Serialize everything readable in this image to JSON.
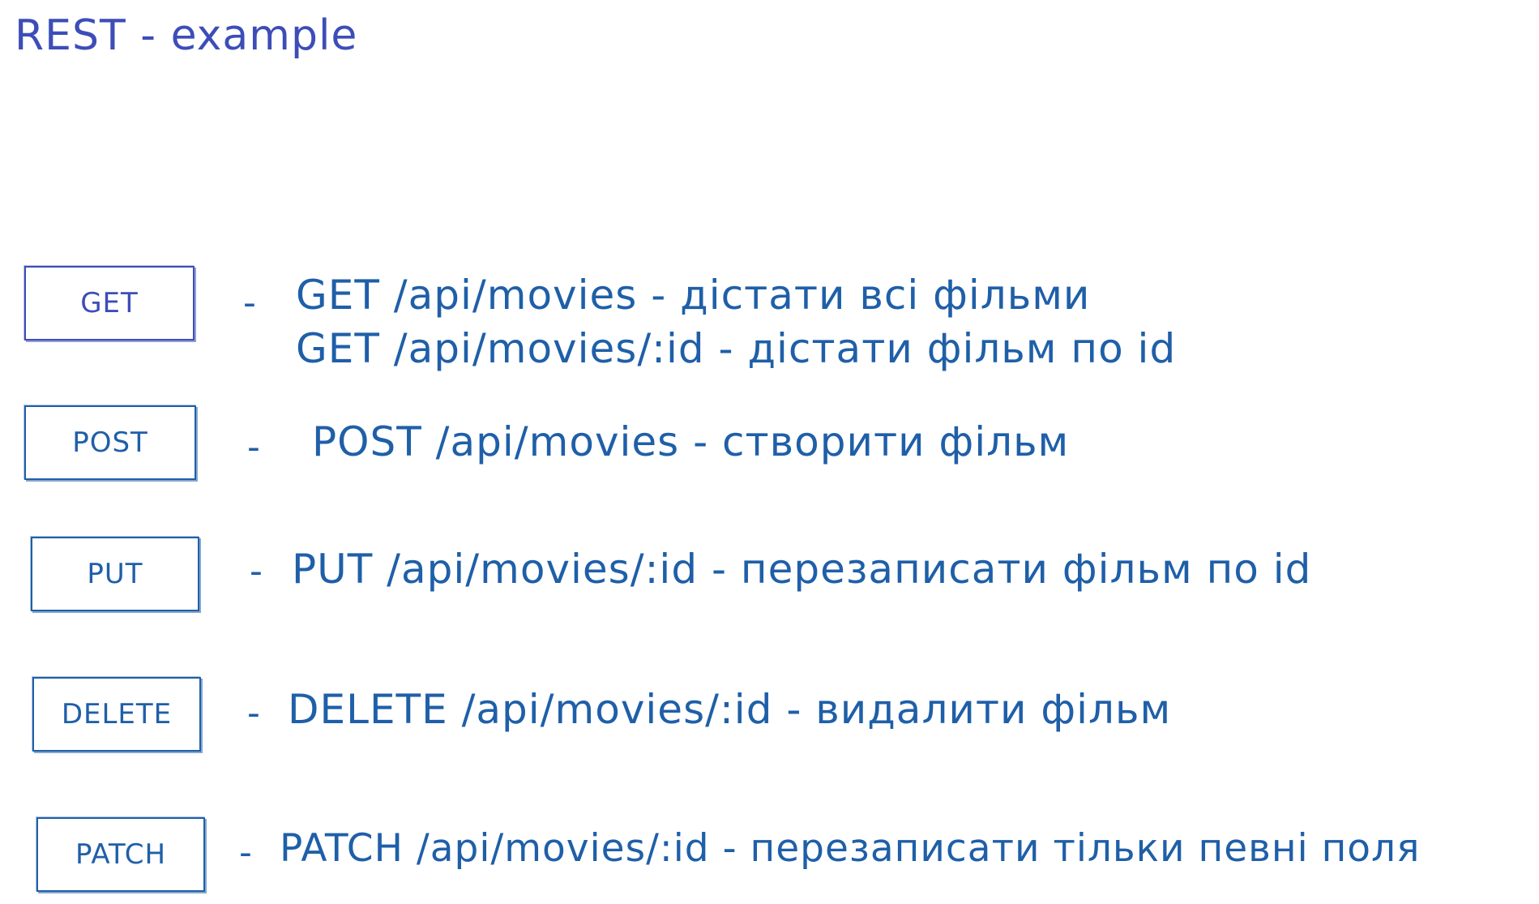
{
  "title": "REST - example",
  "methods": [
    {
      "label": "GET",
      "lines": [
        "GET /api/movies - дістати всі фільми",
        "GET /api/movies/:id - дістати фільм по id"
      ]
    },
    {
      "label": "POST",
      "lines": [
        "POST /api/movies - створити фільм"
      ]
    },
    {
      "label": "PUT",
      "lines": [
        "PUT /api/movies/:id - перезаписати фільм по id"
      ]
    },
    {
      "label": "DELETE",
      "lines": [
        "DELETE /api/movies/:id - видалити фільм"
      ]
    },
    {
      "label": "PATCH",
      "lines": [
        "PATCH /api/movies/:id - перезаписати тільки певні поля"
      ]
    }
  ],
  "separator": "-",
  "colors": {
    "title": "#3d4db8",
    "ink": "#1f5fa8",
    "background": "#ffffff"
  }
}
